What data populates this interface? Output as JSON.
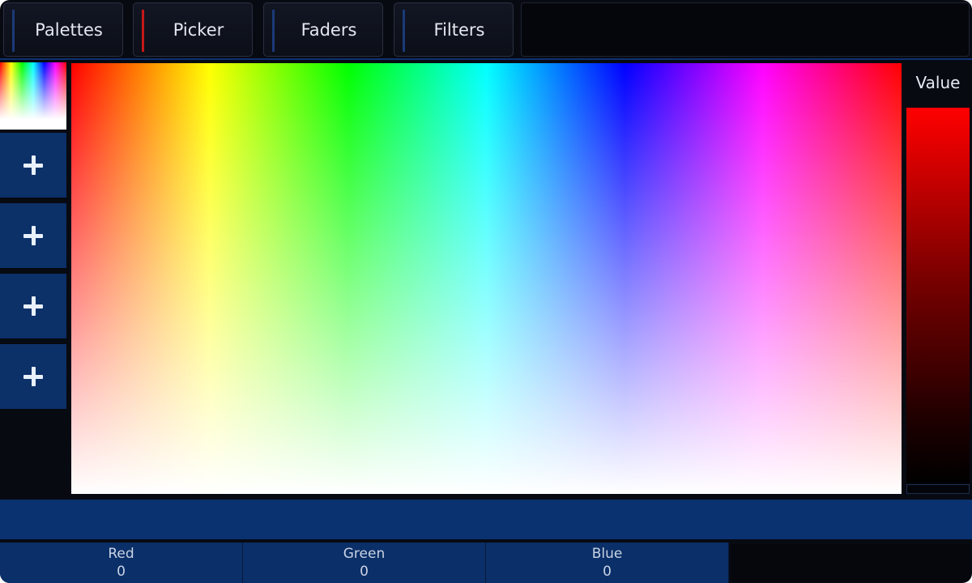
{
  "tabs": [
    {
      "label": "Palettes",
      "active": false
    },
    {
      "label": "Picker",
      "active": true
    },
    {
      "label": "Faders",
      "active": false
    },
    {
      "label": "Filters",
      "active": false
    }
  ],
  "value_panel": {
    "label": "Value"
  },
  "color_field": {
    "hues": [
      "#ff0000",
      "#ffff00",
      "#00ff00",
      "#00ffff",
      "#0000ff",
      "#ff00ff",
      "#ff0000"
    ],
    "fade_to": "#ffffff"
  },
  "readouts": [
    {
      "label": "Red",
      "value": "0"
    },
    {
      "label": "Green",
      "value": "0"
    },
    {
      "label": "Blue",
      "value": "0"
    }
  ],
  "add_buttons": [
    {
      "icon": "plus-icon"
    },
    {
      "icon": "plus-icon"
    },
    {
      "icon": "plus-icon"
    },
    {
      "icon": "plus-icon"
    }
  ],
  "colors": {
    "background": "#080a12",
    "panel_blue": "#0c3068",
    "active_tab_accent": "#c51818",
    "inactive_tab_accent": "#1b3a78"
  }
}
